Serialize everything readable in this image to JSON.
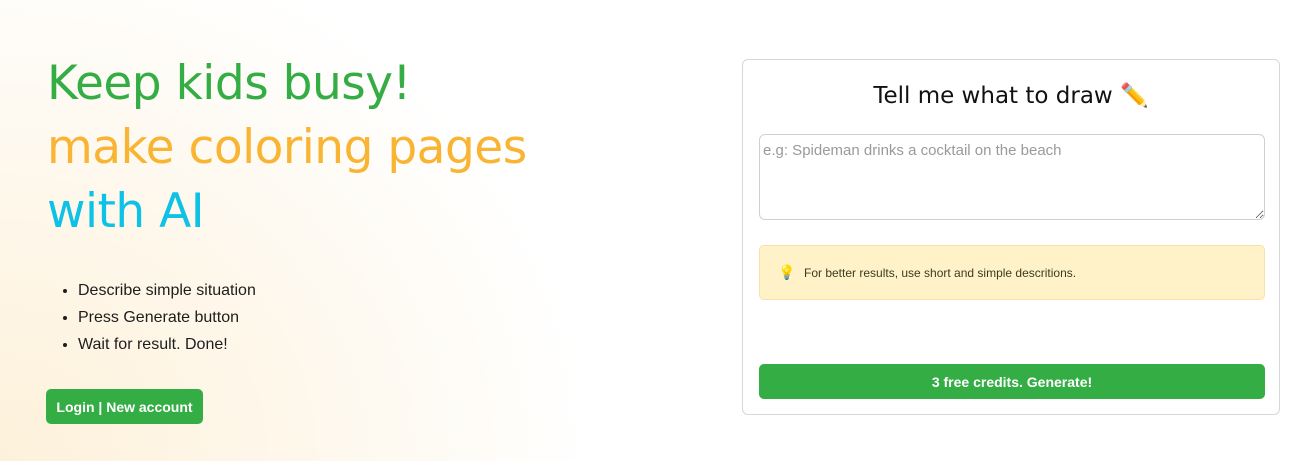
{
  "hero": {
    "line1": "Keep kids busy!",
    "line2": "make coloring pages",
    "line3": "with AI",
    "colors": {
      "green": "#35ad45",
      "orange": "#f8b432",
      "blue": "#0ec1e7"
    }
  },
  "steps": [
    "Describe simple situation",
    "Press Generate button",
    "Wait for result. Done!"
  ],
  "login_label": "Login | New account",
  "card": {
    "title": "Tell me what to draw ✏️",
    "prompt_placeholder": "e.g: Spideman drinks a cocktail on the beach",
    "prompt_value": "",
    "hint_icon": "lightbulb-icon",
    "hint_text": "For better results, use short and simple descritions.",
    "generate_label": "3 free credits. Generate!"
  }
}
